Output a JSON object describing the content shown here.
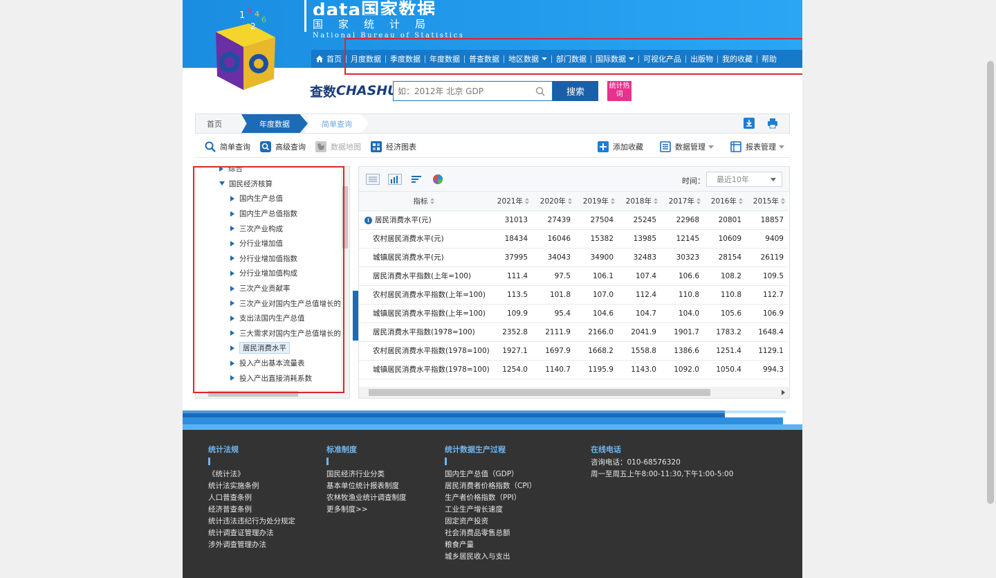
{
  "header": {
    "brand_top": "data国家数据",
    "brand_cn": "国家统计局",
    "brand_en": "National Bureau of Statistics",
    "cube_digits": [
      "1",
      "2",
      "3",
      "4",
      "6"
    ]
  },
  "nav": [
    {
      "label": "首页",
      "caret": false
    },
    {
      "label": "月度数据",
      "caret": false
    },
    {
      "label": "季度数据",
      "caret": false
    },
    {
      "label": "年度数据",
      "caret": false
    },
    {
      "label": "普查数据",
      "caret": false
    },
    {
      "label": "地区数据",
      "caret": true
    },
    {
      "label": "部门数据",
      "caret": false
    },
    {
      "label": "国际数据",
      "caret": true
    },
    {
      "label": "可视化产品",
      "caret": false
    },
    {
      "label": "出版物",
      "caret": false
    },
    {
      "label": "我的收藏",
      "caret": false
    },
    {
      "label": "帮助",
      "caret": false
    }
  ],
  "search": {
    "logo_cn": "查数",
    "logo_en": "CHASHU",
    "placeholder": "如：2012年 北京 GDP",
    "button": "搜索",
    "hot": "统计热词"
  },
  "breadcrumb": {
    "home": "首页",
    "year": "年度数据",
    "current": "简单查询"
  },
  "toolbar": {
    "simple": "简单查询",
    "advanced": "高级查询",
    "map": "数据地图",
    "chart": "经济图表",
    "favorite": "添加收藏",
    "data_mgmt": "数据管理",
    "report_mgmt": "报表管理"
  },
  "tree": {
    "items": [
      {
        "label": "综合",
        "level": 1,
        "expanded": false,
        "selected": false
      },
      {
        "label": "国民经济核算",
        "level": 1,
        "expanded": true,
        "selected": false
      },
      {
        "label": "国内生产总值",
        "level": 2,
        "selected": false
      },
      {
        "label": "国内生产总值指数",
        "level": 2,
        "selected": false
      },
      {
        "label": "三次产业构成",
        "level": 2,
        "selected": false
      },
      {
        "label": "分行业增加值",
        "level": 2,
        "selected": false
      },
      {
        "label": "分行业增加值指数",
        "level": 2,
        "selected": false
      },
      {
        "label": "分行业增加值构成",
        "level": 2,
        "selected": false
      },
      {
        "label": "三次产业贡献率",
        "level": 2,
        "selected": false
      },
      {
        "label": "三次产业对国内生产总值增长的",
        "level": 2,
        "selected": false
      },
      {
        "label": "支出法国内生产总值",
        "level": 2,
        "selected": false
      },
      {
        "label": "三大需求对国内生产总值增长的",
        "level": 2,
        "selected": false
      },
      {
        "label": "居民消费水平",
        "level": 2,
        "selected": true
      },
      {
        "label": "投入产出基本流量表",
        "level": 2,
        "selected": false
      },
      {
        "label": "投入产出直接消耗系数",
        "level": 2,
        "selected": false
      }
    ]
  },
  "table": {
    "time_label": "时间：",
    "time_value": "最近10年",
    "indicator_header": "指标",
    "years": [
      "2021年",
      "2020年",
      "2019年",
      "2018年",
      "2017年",
      "2016年",
      "2015年"
    ],
    "rows": [
      {
        "name": "居民消费水平(元)",
        "info": true,
        "values": [
          "31013",
          "27439",
          "27504",
          "25245",
          "22968",
          "20801",
          "18857"
        ]
      },
      {
        "name": "农村居民消费水平(元)",
        "info": false,
        "values": [
          "18434",
          "16046",
          "15382",
          "13985",
          "12145",
          "10609",
          "9409"
        ]
      },
      {
        "name": "城镇居民消费水平(元)",
        "info": false,
        "values": [
          "37995",
          "34043",
          "34900",
          "32483",
          "30323",
          "28154",
          "26119"
        ]
      },
      {
        "name": "居民消费水平指数(上年=100)",
        "info": false,
        "values": [
          "111.4",
          "97.5",
          "106.1",
          "107.4",
          "106.6",
          "108.2",
          "109.5"
        ]
      },
      {
        "name": "农村居民消费水平指数(上年=100)",
        "info": false,
        "values": [
          "113.5",
          "101.8",
          "107.0",
          "112.4",
          "110.8",
          "110.8",
          "112.7"
        ]
      },
      {
        "name": "城镇居民消费水平指数(上年=100)",
        "info": false,
        "values": [
          "109.9",
          "95.4",
          "104.6",
          "104.7",
          "104.0",
          "105.6",
          "106.9"
        ]
      },
      {
        "name": "居民消费水平指数(1978=100)",
        "info": false,
        "values": [
          "2352.8",
          "2111.9",
          "2166.0",
          "2041.9",
          "1901.7",
          "1783.2",
          "1648.4"
        ]
      },
      {
        "name": "农村居民消费水平指数(1978=100)",
        "info": false,
        "values": [
          "1927.1",
          "1697.9",
          "1668.2",
          "1558.8",
          "1386.6",
          "1251.4",
          "1129.1"
        ]
      },
      {
        "name": "城镇居民消费水平指数(1978=100)",
        "info": false,
        "values": [
          "1254.0",
          "1140.7",
          "1195.9",
          "1143.0",
          "1092.0",
          "1050.4",
          "994.3"
        ]
      }
    ]
  },
  "footer": {
    "col1": {
      "title": "统计法规",
      "items": [
        "《统计法》",
        "统计法实施条例",
        "人口普查条例",
        "经济普查条例",
        "统计违法违纪行为处分规定",
        "统计调查证管理办法",
        "涉外调查管理办法"
      ]
    },
    "col2": {
      "title": "标准制度",
      "items": [
        "国民经济行业分类",
        "基本单位统计报表制度",
        "农林牧渔业统计调查制度",
        "更多制度>>"
      ]
    },
    "col3": {
      "title": "统计数据生产过程",
      "items": [
        "国内生产总值（GDP）",
        "居民消费者价格指数（CPI）",
        "生产者价格指数（PPI）",
        "工业生产增长速度",
        "固定资产投资",
        "社会消费品零售总额",
        "粮食产量",
        "城乡居民收入与支出"
      ]
    },
    "col4": {
      "title": "在线电话",
      "items": [
        "咨询电话：010-68576320",
        "周一至周五上午8:00-11:30,下午1:00-5:00"
      ]
    }
  },
  "colors": {
    "header_blue": "#1e9af0",
    "nav_blue": "#1679c9",
    "accent_dark": "#1c6bb8",
    "hot_pink": "#e8318d",
    "highlight_red": "#e0252b",
    "footer_bg": "#333333"
  }
}
